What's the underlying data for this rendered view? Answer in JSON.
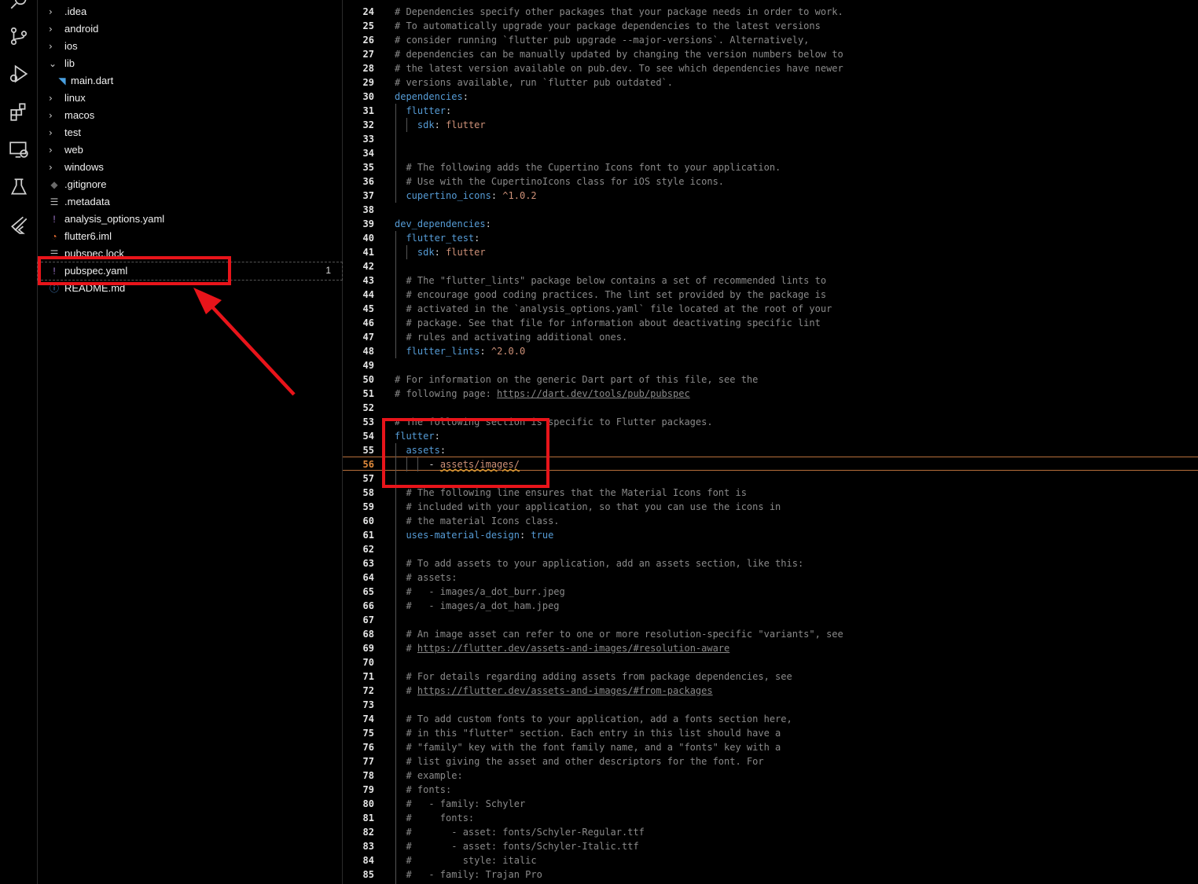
{
  "activity_bar": {
    "icons": [
      "search-icon",
      "source-control-icon",
      "run-debug-icon",
      "extensions-icon",
      "remote-explorer-icon",
      "testing-icon",
      "flutter-icon"
    ]
  },
  "explorer": {
    "items": [
      {
        "label": ".idea",
        "type": "folder",
        "expanded": false
      },
      {
        "label": "android",
        "type": "folder",
        "expanded": false
      },
      {
        "label": "ios",
        "type": "folder",
        "expanded": false
      },
      {
        "label": "lib",
        "type": "folder",
        "expanded": true
      },
      {
        "label": "main.dart",
        "type": "dart"
      },
      {
        "label": "linux",
        "type": "folder",
        "expanded": false
      },
      {
        "label": "macos",
        "type": "folder",
        "expanded": false
      },
      {
        "label": "test",
        "type": "folder",
        "expanded": false
      },
      {
        "label": "web",
        "type": "folder",
        "expanded": false
      },
      {
        "label": "windows",
        "type": "folder",
        "expanded": false
      },
      {
        "label": ".gitignore",
        "type": "git"
      },
      {
        "label": ".metadata",
        "type": "lines"
      },
      {
        "label": "analysis_options.yaml",
        "type": "yaml"
      },
      {
        "label": "flutter6.iml",
        "type": "rss"
      },
      {
        "label": "pubspec.lock",
        "type": "lines"
      },
      {
        "label": "pubspec.yaml",
        "type": "yaml",
        "selected": true,
        "badge": "1"
      },
      {
        "label": "README.md",
        "type": "info"
      }
    ]
  },
  "editor": {
    "active_line": 56,
    "lines": [
      {
        "n": "24",
        "t": "# Dependencies specify other packages that your package needs in order to work."
      },
      {
        "n": "25",
        "t": "# To automatically upgrade your package dependencies to the latest versions"
      },
      {
        "n": "26",
        "t": "# consider running `flutter pub upgrade --major-versions`. Alternatively,"
      },
      {
        "n": "27",
        "t": "# dependencies can be manually updated by changing the version numbers below to"
      },
      {
        "n": "28",
        "t": "# the latest version available on pub.dev. To see which dependencies have newer"
      },
      {
        "n": "29",
        "t": "# versions available, run `flutter pub outdated`."
      },
      {
        "n": "30",
        "t": "dependencies:"
      },
      {
        "n": "31",
        "t": "  flutter:"
      },
      {
        "n": "32",
        "t": "    sdk: flutter"
      },
      {
        "n": "33",
        "t": ""
      },
      {
        "n": "34",
        "t": ""
      },
      {
        "n": "35",
        "t": "  # The following adds the Cupertino Icons font to your application."
      },
      {
        "n": "36",
        "t": "  # Use with the CupertinoIcons class for iOS style icons."
      },
      {
        "n": "37",
        "t": "  cupertino_icons: ^1.0.2"
      },
      {
        "n": "38",
        "t": ""
      },
      {
        "n": "39",
        "t": "dev_dependencies:"
      },
      {
        "n": "40",
        "t": "  flutter_test:"
      },
      {
        "n": "41",
        "t": "    sdk: flutter"
      },
      {
        "n": "42",
        "t": ""
      },
      {
        "n": "43",
        "t": "  # The \"flutter_lints\" package below contains a set of recommended lints to"
      },
      {
        "n": "44",
        "t": "  # encourage good coding practices. The lint set provided by the package is"
      },
      {
        "n": "45",
        "t": "  # activated in the `analysis_options.yaml` file located at the root of your"
      },
      {
        "n": "46",
        "t": "  # package. See that file for information about deactivating specific lint"
      },
      {
        "n": "47",
        "t": "  # rules and activating additional ones."
      },
      {
        "n": "48",
        "t": "  flutter_lints: ^2.0.0"
      },
      {
        "n": "49",
        "t": ""
      },
      {
        "n": "50",
        "t": "# For information on the generic Dart part of this file, see the"
      },
      {
        "n": "51",
        "t": "# following page: https://dart.dev/tools/pub/pubspec"
      },
      {
        "n": "52",
        "t": ""
      },
      {
        "n": "53",
        "t": "# The following section is specific to Flutter packages."
      },
      {
        "n": "54",
        "t": "flutter:"
      },
      {
        "n": "55",
        "t": "  assets:"
      },
      {
        "n": "56",
        "t": "      - assets/images/"
      },
      {
        "n": "57",
        "t": ""
      },
      {
        "n": "58",
        "t": "  # The following line ensures that the Material Icons font is"
      },
      {
        "n": "59",
        "t": "  # included with your application, so that you can use the icons in"
      },
      {
        "n": "60",
        "t": "  # the material Icons class."
      },
      {
        "n": "61",
        "t": "  uses-material-design: true"
      },
      {
        "n": "62",
        "t": ""
      },
      {
        "n": "63",
        "t": "  # To add assets to your application, add an assets section, like this:"
      },
      {
        "n": "64",
        "t": "  # assets:"
      },
      {
        "n": "65",
        "t": "  #   - images/a_dot_burr.jpeg"
      },
      {
        "n": "66",
        "t": "  #   - images/a_dot_ham.jpeg"
      },
      {
        "n": "67",
        "t": ""
      },
      {
        "n": "68",
        "t": "  # An image asset can refer to one or more resolution-specific \"variants\", see"
      },
      {
        "n": "69",
        "t": "  # https://flutter.dev/assets-and-images/#resolution-aware"
      },
      {
        "n": "70",
        "t": ""
      },
      {
        "n": "71",
        "t": "  # For details regarding adding assets from package dependencies, see"
      },
      {
        "n": "72",
        "t": "  # https://flutter.dev/assets-and-images/#from-packages"
      },
      {
        "n": "73",
        "t": ""
      },
      {
        "n": "74",
        "t": "  # To add custom fonts to your application, add a fonts section here,"
      },
      {
        "n": "75",
        "t": "  # in this \"flutter\" section. Each entry in this list should have a"
      },
      {
        "n": "76",
        "t": "  # \"family\" key with the font family name, and a \"fonts\" key with a"
      },
      {
        "n": "77",
        "t": "  # list giving the asset and other descriptors for the font. For"
      },
      {
        "n": "78",
        "t": "  # example:"
      },
      {
        "n": "79",
        "t": "  # fonts:"
      },
      {
        "n": "80",
        "t": "  #   - family: Schyler"
      },
      {
        "n": "81",
        "t": "  #     fonts:"
      },
      {
        "n": "82",
        "t": "  #       - asset: fonts/Schyler-Regular.ttf"
      },
      {
        "n": "83",
        "t": "  #       - asset: fonts/Schyler-Italic.ttf"
      },
      {
        "n": "84",
        "t": "  #         style: italic"
      },
      {
        "n": "85",
        "t": "  #   - family: Trajan Pro"
      }
    ]
  },
  "colors": {
    "annotation": "#e8141a",
    "comment": "#8a8a8a",
    "key": "#569cd6",
    "value": "#ce9178",
    "active_line_number": "#e08a3c"
  }
}
